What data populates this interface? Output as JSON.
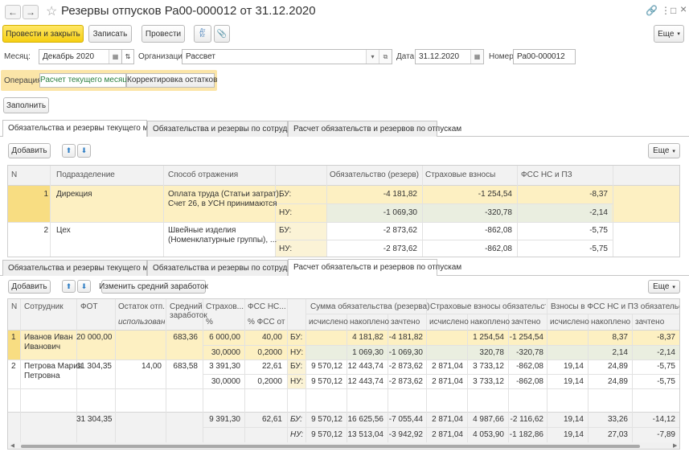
{
  "window": {
    "title": "Резервы отпусков Ра00-000012 от 31.12.2020",
    "back_icon": "←",
    "forward_icon": "→",
    "star_icon": "☆",
    "link_icon": "🔗",
    "more_icon": "⋮",
    "restore_icon": "□",
    "close_icon": "×"
  },
  "toolbar": {
    "post_close": "Провести и закрыть",
    "save": "Записать",
    "post": "Провести",
    "dtkt": "Дт Кт",
    "attach_icon": "📎",
    "more": "Еще"
  },
  "header": {
    "month_label": "Месяц:",
    "month_value": "Декабрь 2020",
    "org_label": "Организация:",
    "org_value": "Рассвет",
    "date_label": "Дата:",
    "date_value": "31.12.2020",
    "number_label": "Номер:",
    "number_value": "Ра00-000012"
  },
  "operation": {
    "label": "Операция:",
    "options": [
      "Расчет текущего месяца",
      "Корректировка остатков"
    ]
  },
  "fill_button": "Заполнить",
  "tabs1": [
    "Обязательства и резервы текущего месяца",
    "Обязательства и резервы по сотрудникам",
    "Расчет обязательств и резервов по отпускам"
  ],
  "grid1": {
    "add": "Добавить",
    "more": "Еще",
    "columns": [
      "N",
      "Подразделение",
      "Способ отражения",
      "",
      "Обязательство (резерв)",
      "Страховые взносы",
      "ФСС НС и ПЗ"
    ],
    "rows": [
      {
        "n": "1",
        "dept": "Дирекция",
        "method": [
          "Оплата труда (Статьи затрат),",
          "Счет 26, в УСН принимаются"
        ],
        "lines": [
          {
            "type": "БУ:",
            "liability": "-4 181,82",
            "insurance": "-1 254,54",
            "fss": "-8,37"
          },
          {
            "type": "НУ:",
            "liability": "-1 069,30",
            "insurance": "-320,78",
            "fss": "-2,14"
          }
        ]
      },
      {
        "n": "2",
        "dept": "Цех",
        "method": [
          "Швейные изделия",
          "(Номенклатурные группы), ..."
        ],
        "lines": [
          {
            "type": "БУ:",
            "liability": "-2 873,62",
            "insurance": "-862,08",
            "fss": "-5,75"
          },
          {
            "type": "НУ:",
            "liability": "-2 873,62",
            "insurance": "-862,08",
            "fss": "-5,75"
          }
        ]
      }
    ]
  },
  "tabs2": [
    "Обязательства и резервы текущего месяца",
    "Обязательства и резервы по сотрудникам",
    "Расчет обязательств и резервов по отпускам"
  ],
  "grid2": {
    "add": "Добавить",
    "change_avg": "Изменить средний заработок",
    "more": "Еще",
    "headers": {
      "n": "N",
      "employee": "Сотрудник",
      "fot": "ФОТ",
      "balance": "Остаток отп...",
      "balance_sub": "использован",
      "avg": [
        "Средний",
        "заработок"
      ],
      "ins": "Страхов...",
      "ins_sub": "%",
      "fss": "ФСС НС...",
      "fss_sub": "% ФСС от",
      "sum_group": "Сумма обязательства (резерва)",
      "ins_group": "Страховые взносы обязательства ...",
      "fss_group": "Взносы в ФСС НС и ПЗ обязательств...",
      "calc": "исчислено",
      "acc": "накоплено",
      "counted": "зачтено"
    },
    "rows": [
      {
        "n": "1",
        "name": [
          "Иванов Иван",
          "Иванович"
        ],
        "fot": "20 000,00",
        "balance": "",
        "avg": "683,36",
        "lines": [
          {
            "ins": "6 000,00",
            "fss": "40,00",
            "type": "БУ:",
            "s_calc": "",
            "s_acc": "4 181,82",
            "s_cnt": "-4 181,82",
            "i_calc": "",
            "i_acc": "1 254,54",
            "i_cnt": "-1 254,54",
            "f_calc": "",
            "f_acc": "8,37",
            "f_cnt": "-8,37"
          },
          {
            "ins": "30,0000",
            "fss": "0,2000",
            "type": "НУ:",
            "s_calc": "",
            "s_acc": "1 069,30",
            "s_cnt": "-1 069,30",
            "i_calc": "",
            "i_acc": "320,78",
            "i_cnt": "-320,78",
            "f_calc": "",
            "f_acc": "2,14",
            "f_cnt": "-2,14"
          }
        ]
      },
      {
        "n": "2",
        "name": [
          "Петрова Мария",
          "Петровна"
        ],
        "fot": "11 304,35",
        "balance": "14,00",
        "avg": "683,58",
        "lines": [
          {
            "ins": "3 391,30",
            "fss": "22,61",
            "type": "БУ:",
            "s_calc": "9 570,12",
            "s_acc": "12 443,74",
            "s_cnt": "-2 873,62",
            "i_calc": "2 871,04",
            "i_acc": "3 733,12",
            "i_cnt": "-862,08",
            "f_calc": "19,14",
            "f_acc": "24,89",
            "f_cnt": "-5,75"
          },
          {
            "ins": "30,0000",
            "fss": "0,2000",
            "type": "НУ:",
            "s_calc": "9 570,12",
            "s_acc": "12 443,74",
            "s_cnt": "-2 873,62",
            "i_calc": "2 871,04",
            "i_acc": "3 733,12",
            "i_cnt": "-862,08",
            "f_calc": "19,14",
            "f_acc": "24,89",
            "f_cnt": "-5,75"
          }
        ]
      }
    ],
    "totals": {
      "fot": "31 304,35",
      "ins": "9 391,30",
      "fss": "62,61",
      "lines": [
        {
          "type": "БУ:",
          "s_calc": "9 570,12",
          "s_acc": "16 625,56",
          "s_cnt": "-7 055,44",
          "i_calc": "2 871,04",
          "i_acc": "4 987,66",
          "i_cnt": "-2 116,62",
          "f_calc": "19,14",
          "f_acc": "33,26",
          "f_cnt": "-14,12"
        },
        {
          "type": "НУ:",
          "s_calc": "9 570,12",
          "s_acc": "13 513,04",
          "s_cnt": "-3 942,92",
          "i_calc": "2 871,04",
          "i_acc": "4 053,90",
          "i_cnt": "-1 182,86",
          "f_calc": "19,14",
          "f_acc": "27,03",
          "f_cnt": "-7,89"
        }
      ]
    }
  },
  "icons": {
    "calendar": "▦",
    "dropdown": "▾",
    "open": "⧉",
    "up": "⬆",
    "down": "⬇"
  }
}
